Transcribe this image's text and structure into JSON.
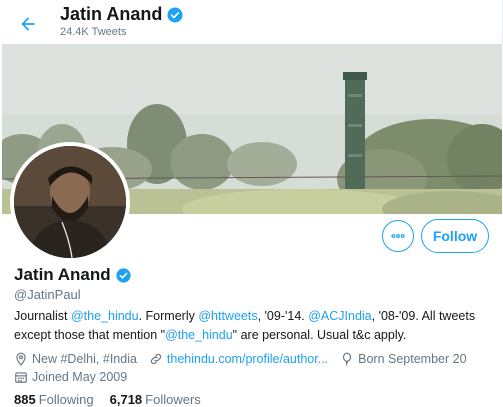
{
  "header": {
    "name": "Jatin Anand",
    "tweets_count": "24.4K Tweets"
  },
  "profile": {
    "name": "Jatin Anand",
    "handle": "@JatinPaul",
    "bio": {
      "t1": "Journalist ",
      "m1": "@the_hindu",
      "t2": ". Formerly ",
      "m2": "@httweets",
      "t3": ", '09-'14. ",
      "m3": "@ACJIndia",
      "t4": ", '08-'09. All tweets except those that mention \"",
      "m4": "@the_hindu",
      "t5": "\" are personal. Usual t&c apply."
    },
    "location": "New #Delhi, #India",
    "website": "thehindu.com/profile/author...",
    "birthday": "Born September 20",
    "joined": "Joined May 2009",
    "following_count": "885",
    "following_label": "Following",
    "followers_count": "6,718",
    "followers_label": "Followers"
  },
  "actions": {
    "follow_label": "Follow"
  },
  "icons": {
    "back": "arrow-left-icon",
    "verified": "verified-badge-icon",
    "more": "more-dots-icon",
    "location": "location-pin-icon",
    "link": "link-icon",
    "birthday": "balloon-icon",
    "calendar": "calendar-icon"
  },
  "colors": {
    "accent": "#1da1f2",
    "text": "#14171a",
    "secondary": "#657786"
  }
}
